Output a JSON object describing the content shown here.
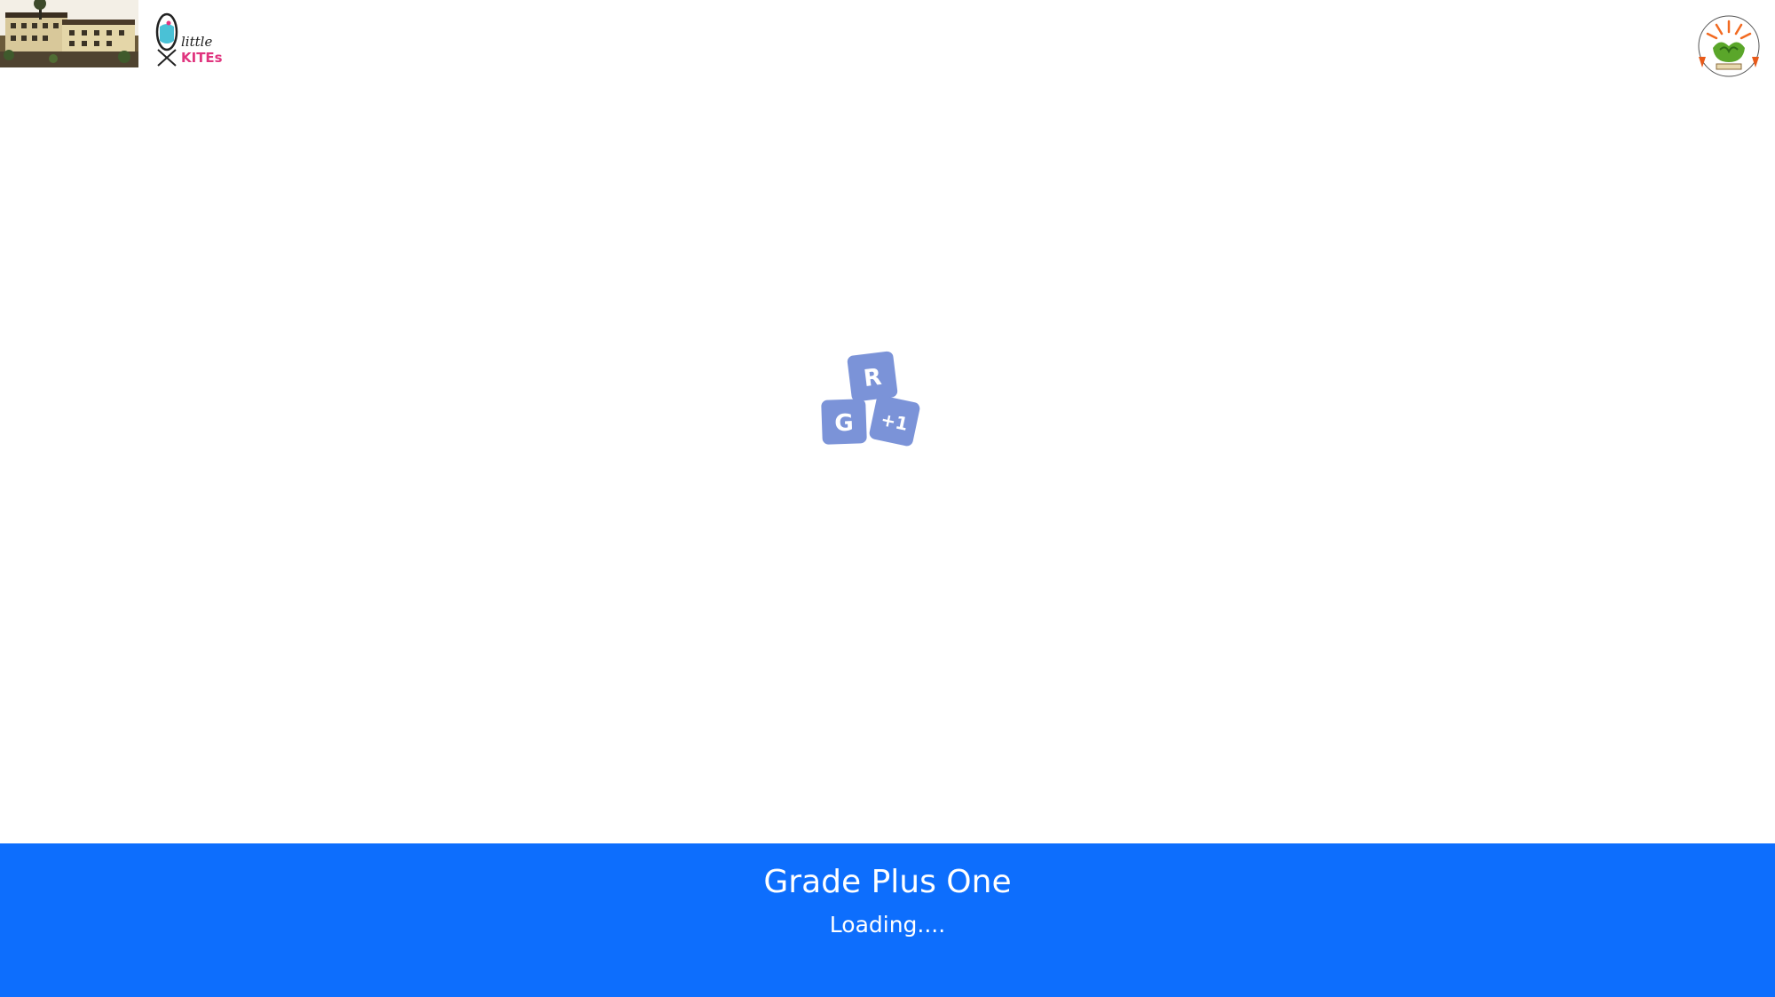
{
  "header": {
    "school_photo_icon": "school-building-photo",
    "kites_logo": {
      "line1": "little",
      "line2": "KITEs"
    },
    "emblem_icon": "school-emblem-icon"
  },
  "loader": {
    "tiles": [
      "R",
      "G",
      "+1"
    ],
    "color": "#7b93d8"
  },
  "footer": {
    "title": "Grade Plus One",
    "status": "Loading....",
    "background": "#0d6efd"
  }
}
